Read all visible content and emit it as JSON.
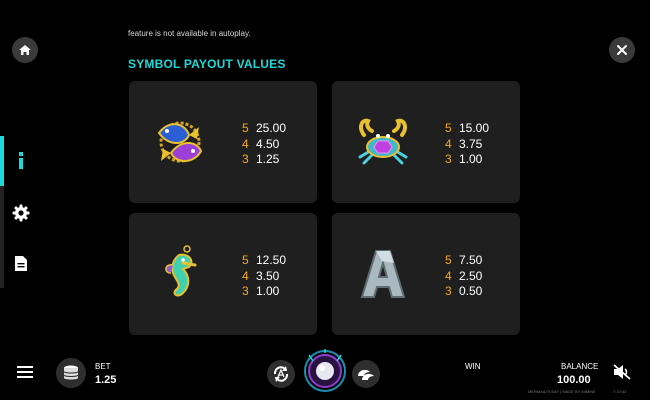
{
  "intro_text": "feature is not available in autoplay.",
  "section_title": "SYMBOL PAYOUT VALUES",
  "symbols": [
    {
      "name": "twin fish",
      "pays": [
        {
          "count": "5",
          "value": "25.00"
        },
        {
          "count": "4",
          "value": "4.50"
        },
        {
          "count": "3",
          "value": "1.25"
        }
      ]
    },
    {
      "name": "crab",
      "pays": [
        {
          "count": "5",
          "value": "15.00"
        },
        {
          "count": "4",
          "value": "3.75"
        },
        {
          "count": "3",
          "value": "1.00"
        }
      ]
    },
    {
      "name": "seahorse",
      "pays": [
        {
          "count": "5",
          "value": "12.50"
        },
        {
          "count": "4",
          "value": "3.50"
        },
        {
          "count": "3",
          "value": "1.00"
        }
      ]
    },
    {
      "name": "A",
      "pays": [
        {
          "count": "5",
          "value": "7.50"
        },
        {
          "count": "4",
          "value": "2.50"
        },
        {
          "count": "3",
          "value": "0.50"
        }
      ]
    }
  ],
  "bottom_bar": {
    "bet_label": "BET",
    "bet_value": "1.25",
    "win_label": "WIN",
    "balance_label": "BALANCE",
    "balance_value": "100.00",
    "footer_left": "MERMAID'S BAY | MADE BY MIMINE",
    "footer_right": "7:10:42"
  },
  "colors": {
    "accent": "#1ed9d9",
    "count": "#f5a623",
    "card": "#1f1f1f"
  },
  "icons": [
    "home-icon",
    "close-icon",
    "info-icon",
    "gear-icon",
    "document-icon",
    "menu-icon",
    "coin-stack-icon",
    "autoplay-icon",
    "spin-button",
    "turbo-icon",
    "sound-muted-icon"
  ]
}
